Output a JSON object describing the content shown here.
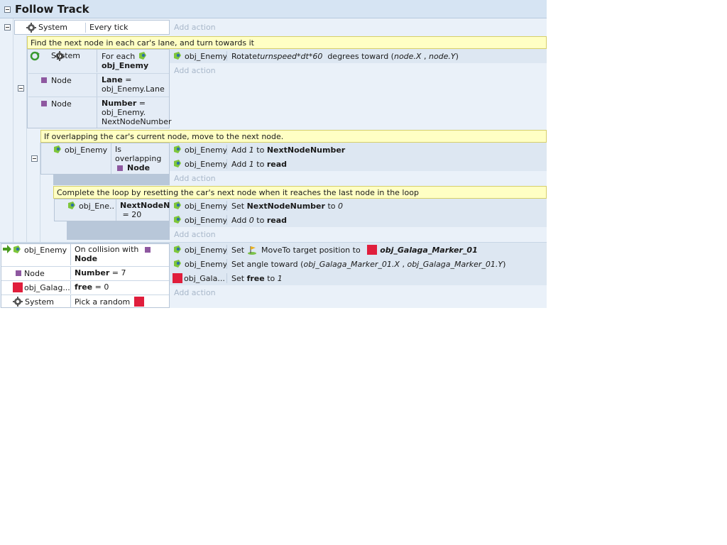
{
  "group_title": "Follow Track",
  "add_action_label": "Add action",
  "event1": {
    "obj": "System",
    "cond": "Every tick"
  },
  "comment1": "Find the next node in each car's lane, and turn towards it",
  "sub1": {
    "cond1_obj": "System",
    "cond1_line1": "For each",
    "cond1_line2": "obj_Enemy",
    "cond2_obj": "Node",
    "cond2_bold": "Lane",
    "cond2_rest1": " =",
    "cond2_line2": "obj_Enemy.Lane",
    "cond3_obj": "Node",
    "cond3_bold": "Number",
    "cond3_rest1": " =",
    "cond3_line2": "obj_Enemy.",
    "cond3_line3": "NextNodeNumber",
    "action1_obj": "obj_Enemy",
    "action1_a": "Rotate ",
    "action1_b": "turnspeed*dt*60",
    "action1_c": "  degrees toward (",
    "action1_d": "node.X",
    "action1_e": " , ",
    "action1_f": "node.Y",
    "action1_g": ")"
  },
  "comment2": "If overlapping the car's current node, move to the next node.",
  "sub2": {
    "cond_obj": "obj_Enemy",
    "cond_line1": "Is",
    "cond_line2": "overlapping",
    "cond_line3": "Node",
    "act1_obj": "obj_Enemy",
    "act1_a": "Add ",
    "act1_b": "1",
    "act1_c": " to ",
    "act1_d": "NextNodeNumber",
    "act2_obj": "obj_Enemy",
    "act2_a": "Add ",
    "act2_b": "1",
    "act2_c": " to ",
    "act2_d": "read"
  },
  "comment3": "Complete the loop by resetting the car's next node when it reaches the last node in the loop",
  "sub3": {
    "cond_obj": "obj_Ene...",
    "cond_line1": "NextNodeNu",
    "cond_line2": " = 20",
    "act1_obj": "obj_Enemy",
    "act1_a": "Set ",
    "act1_b": "NextNodeNumber",
    "act1_c": " to ",
    "act1_d": "0",
    "act2_obj": "obj_Enemy",
    "act2_a": "Add ",
    "act2_b": "0",
    "act2_c": " to ",
    "act2_d": "read"
  },
  "event2": {
    "c1_obj": "obj_Enemy",
    "c1_line1": "On collision with",
    "c1_line2": "Node",
    "c2_obj": "Node",
    "c2_bold": "Number",
    "c2_rest": " = 7",
    "c3_obj": "obj_Galag...",
    "c3_bold": "free",
    "c3_rest": " = 0",
    "c4_obj": "System",
    "c4_text": "Pick a random",
    "a1_obj": "obj_Enemy",
    "a1_a": "Set ",
    "a1_b": " MoveTo target position to ",
    "a1_c": "obj_Galaga_Marker_01",
    "a2_obj": "obj_Enemy",
    "a2_a": "Set angle toward (",
    "a2_b": "obj_Galaga_Marker_01.X",
    "a2_c": " , ",
    "a2_d": "obj_Galaga_Marker_01.Y",
    "a2_e": ")",
    "a3_obj": "obj_Gala...",
    "a3_a": "Set ",
    "a3_b": "free",
    "a3_c": " to ",
    "a3_d": "1"
  }
}
